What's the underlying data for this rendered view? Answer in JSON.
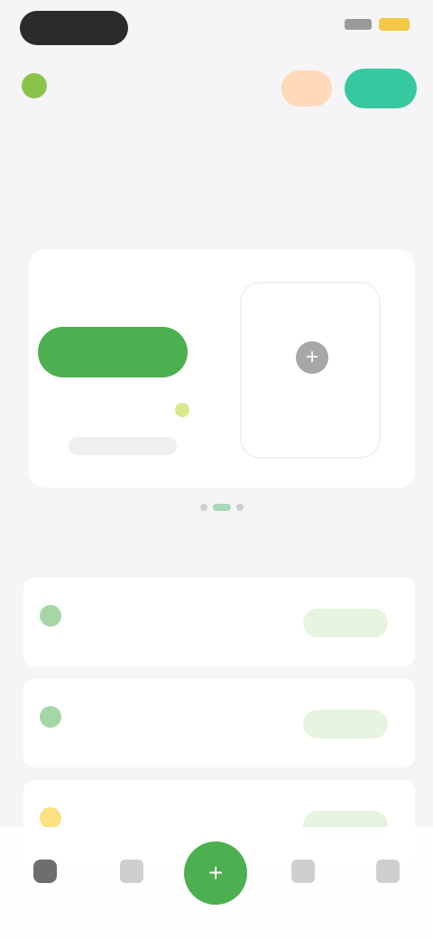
{
  "status_bar": {
    "time": ""
  },
  "header": {
    "logo_text": "",
    "orange_button_label": "",
    "teal_button_label": ""
  },
  "center_title": "",
  "section1": {
    "title": "",
    "link": ""
  },
  "main_card": {
    "top_text": "",
    "green_button_label": "",
    "caption": "",
    "add_icon": "plus-icon",
    "add_label": ""
  },
  "page_indicator": {
    "total": 3,
    "active_index": 1
  },
  "section2": {
    "title": ""
  },
  "list_items": [
    {
      "icon_color": "#a5d6a7",
      "title": "",
      "subtitle": "",
      "button_label": ""
    },
    {
      "icon_color": "#a5d6a7",
      "title": "",
      "subtitle": "",
      "button_label": ""
    },
    {
      "icon_color": "#ffe082",
      "title": "",
      "subtitle": "",
      "button_label": ""
    }
  ],
  "bottom_nav": {
    "items": [
      {
        "label": "",
        "icon": "home-icon"
      },
      {
        "label": "",
        "icon": "grid-icon"
      },
      {
        "label": "",
        "icon": "plus-icon"
      },
      {
        "label": "",
        "icon": "message-icon"
      },
      {
        "label": "",
        "icon": "profile-icon"
      }
    ]
  },
  "colors": {
    "accent": "#4caf50",
    "teal": "#36c9a0",
    "light_green": "#e7f4df"
  }
}
